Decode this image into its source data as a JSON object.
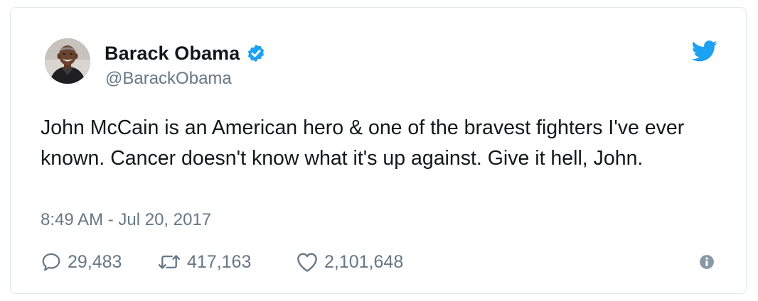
{
  "user": {
    "display_name": "Barack Obama",
    "handle": "@BarackObama",
    "verified": true
  },
  "tweet": {
    "text": "John McCain is an American hero & one of the bravest fighters I've ever known. Cancer doesn't know what it's up against. Give it hell, John.",
    "timestamp": "8:49 AM - Jul 20, 2017"
  },
  "actions": {
    "replies": "29,483",
    "retweets": "417,163",
    "likes": "2,101,648"
  },
  "icons": {
    "verified": "verified-badge-icon",
    "brand": "twitter-bird-icon",
    "reply": "speech-bubble-icon",
    "retweet": "retweet-arrows-icon",
    "like": "heart-icon",
    "info": "info-icon"
  },
  "colors": {
    "twitter_blue": "#1da1f2",
    "text_primary": "#14171a",
    "text_secondary": "#657786",
    "border": "#e1e8ed"
  }
}
